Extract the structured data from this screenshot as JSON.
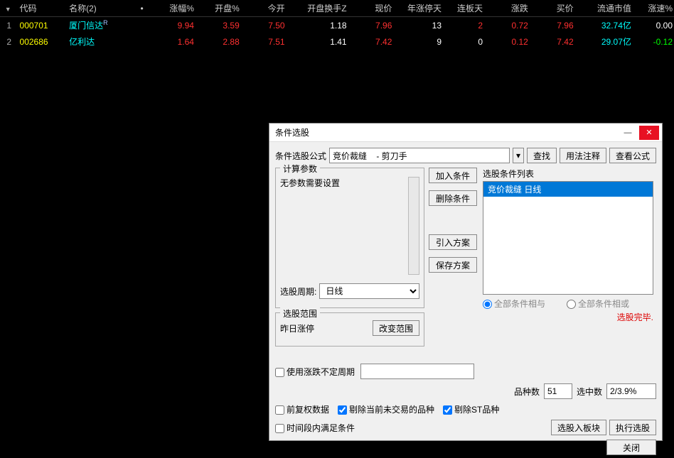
{
  "table": {
    "headers": {
      "idx": "",
      "code": "代码",
      "name": "名称(2)",
      "dot": "•",
      "change_pct": "涨幅%",
      "open_pct": "开盘%",
      "jinkai": "今开",
      "open_turnover": "开盘换手Z",
      "price": "现价",
      "year_zt_days": "年涨停天",
      "lianban": "连板天",
      "zhangdie": "涨跌",
      "buy": "买价",
      "market_cap": "流通市值",
      "zhangsu": "涨速%"
    },
    "rows": [
      {
        "idx": "1",
        "code": "000701",
        "name": "厦门信达",
        "name_sup": "R",
        "change_pct": "9.94",
        "open_pct": "3.59",
        "jinkai": "7.50",
        "open_turnover": "1.18",
        "price": "7.96",
        "year_zt_days": "13",
        "lianban": "2",
        "zhangdie": "0.72",
        "buy": "7.96",
        "market_cap": "32.74亿",
        "zhangsu": "0.00",
        "lianban_class": "red",
        "zs_class": "white"
      },
      {
        "idx": "2",
        "code": "002686",
        "name": "亿利达",
        "name_sup": "",
        "change_pct": "1.64",
        "open_pct": "2.88",
        "jinkai": "7.51",
        "open_turnover": "1.41",
        "price": "7.42",
        "year_zt_days": "9",
        "lianban": "0",
        "zhangdie": "0.12",
        "buy": "7.42",
        "market_cap": "29.07亿",
        "zhangsu": "-0.12",
        "lianban_class": "white",
        "zs_class": "green"
      }
    ]
  },
  "dialog": {
    "title": "条件选股",
    "formula_label": "条件选股公式",
    "formula_value": "竞价裁缝    - 剪刀手",
    "find_btn": "查找",
    "usage_btn": "用法注释",
    "view_formula_btn": "查看公式",
    "calc_params_legend": "计算参数",
    "no_params_text": "无参数需要设置",
    "period_label": "选股周期:",
    "period_value": "日线",
    "add_cond_btn": "加入条件",
    "del_cond_btn": "删除条件",
    "import_plan_btn": "引入方案",
    "save_plan_btn": "保存方案",
    "cond_list_label": "选股条件列表",
    "cond_list_item": "竞价裁缝  日线",
    "radio_and": "全部条件相与",
    "radio_or": "全部条件相或",
    "status": "选股完毕.",
    "range_legend": "选股范围",
    "range_text": "昨日涨停",
    "change_range_btn": "改变范围",
    "use_undef_period": "使用涨跌不定周期",
    "variety_count_label": "品种数",
    "variety_count_value": "51",
    "selected_label": "选中数",
    "selected_value": "2/3.9%",
    "front_adjust": "前复权数据",
    "remove_nontrade": "剔除当前未交易的品种",
    "remove_st": "剔除ST品种",
    "time_satisfy": "时间段内满足条件",
    "into_block_btn": "选股入板块",
    "exec_btn": "执行选股",
    "close_btn": "关闭"
  }
}
